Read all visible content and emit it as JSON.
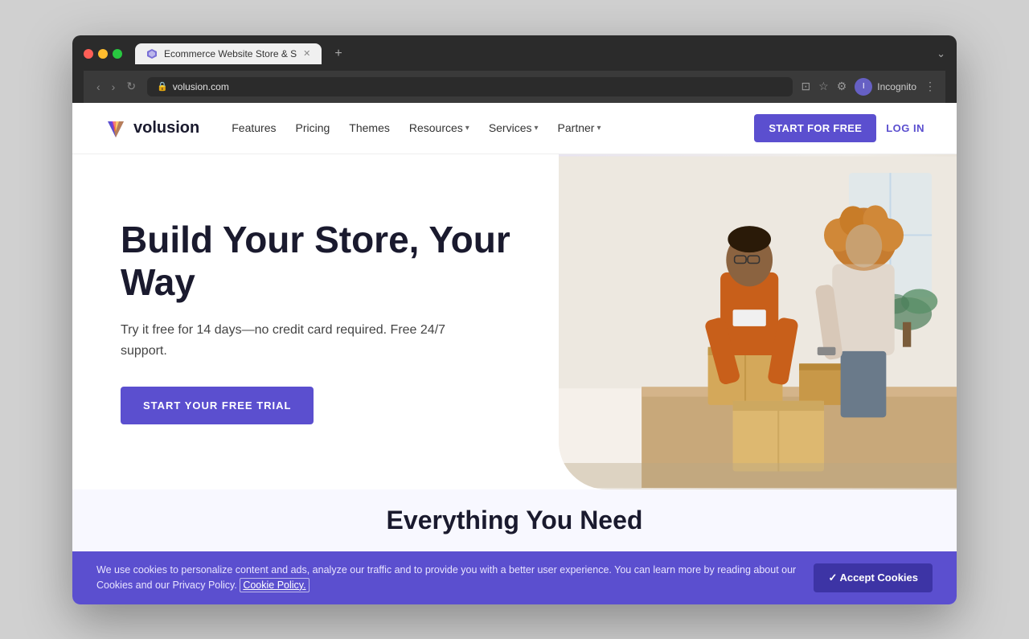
{
  "browser": {
    "tab_title": "Ecommerce Website Store & S",
    "url": "volusion.com",
    "incognito_label": "Incognito"
  },
  "nav": {
    "logo_text": "volusion",
    "links": [
      {
        "label": "Features",
        "has_dropdown": false
      },
      {
        "label": "Pricing",
        "has_dropdown": false
      },
      {
        "label": "Themes",
        "has_dropdown": false
      },
      {
        "label": "Resources",
        "has_dropdown": true
      },
      {
        "label": "Services",
        "has_dropdown": true
      },
      {
        "label": "Partner",
        "has_dropdown": true
      }
    ],
    "cta_start": "START FOR FREE",
    "cta_login": "LOG IN"
  },
  "hero": {
    "title": "Build Your Store, Your Way",
    "subtitle": "Try it free for 14 days—no credit card required. Free 24/7 support.",
    "cta_button": "START YOUR FREE TRIAL"
  },
  "section_teaser": {
    "title": "Everything You Need"
  },
  "cookie": {
    "text": "We use cookies to personalize content and ads, analyze our traffic and to provide you with a better user experience. You can learn more by reading about our Cookies and our Privacy Policy.",
    "link_text": "Cookie Policy.",
    "accept_button": "✓ Accept Cookies"
  },
  "colors": {
    "primary": "#5b4fcf",
    "dark": "#1a1a2e",
    "text_body": "#444444"
  }
}
